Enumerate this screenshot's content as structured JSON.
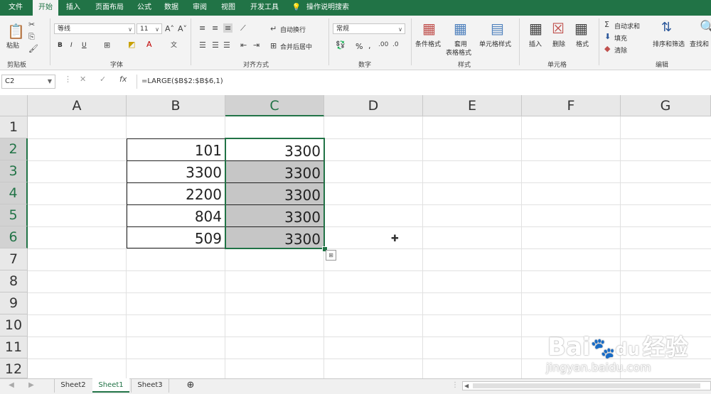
{
  "ribbon_tabs": [
    "文件",
    "开始",
    "插入",
    "页面布局",
    "公式",
    "数据",
    "审阅",
    "视图",
    "开发工具",
    "操作说明搜索"
  ],
  "active_tab": "开始",
  "clipboard": {
    "paste": "粘贴",
    "group": "剪贴板"
  },
  "font": {
    "name": "等线",
    "size": "11",
    "group": "字体",
    "bold": "B",
    "italic": "I",
    "underline": "U"
  },
  "alignment": {
    "wrap": "自动换行",
    "merge": "合并后居中",
    "group": "对齐方式"
  },
  "number": {
    "format": "常规",
    "percent": "%",
    "comma": ",",
    "group": "数字"
  },
  "styles": {
    "conditional": "条件格式",
    "table1": "套用",
    "table2": "表格格式",
    "cell_styles": "单元格样式",
    "group": "样式"
  },
  "cells": {
    "insert": "插入",
    "delete": "删除",
    "format": "格式",
    "group": "单元格"
  },
  "editing": {
    "autosum": "自动求和",
    "fill": "填充",
    "clear": "清除",
    "sort": "排序和筛选",
    "find": "查找和",
    "group": "编辑"
  },
  "namebox": "C2",
  "formula": "=LARGE($B$2:$B$6,1)",
  "columns": [
    "A",
    "B",
    "C",
    "D",
    "E",
    "F",
    "G"
  ],
  "rows": [
    "1",
    "2",
    "3",
    "4",
    "5",
    "6",
    "7",
    "8",
    "9",
    "10",
    "11",
    "12"
  ],
  "column_b": [
    "101",
    "3300",
    "2200",
    "804",
    "509"
  ],
  "column_c": [
    "3300",
    "3300",
    "3300",
    "3300",
    "3300"
  ],
  "sheets": [
    "Sheet2",
    "Sheet1",
    "Sheet3"
  ],
  "active_sheet": "Sheet1",
  "watermark": {
    "main": "Bai",
    "du": "du",
    "jy": "经验",
    "url": "jingyan.baidu.com"
  },
  "colors": {
    "accent": "#217346",
    "selection": "#c6c6c6"
  }
}
